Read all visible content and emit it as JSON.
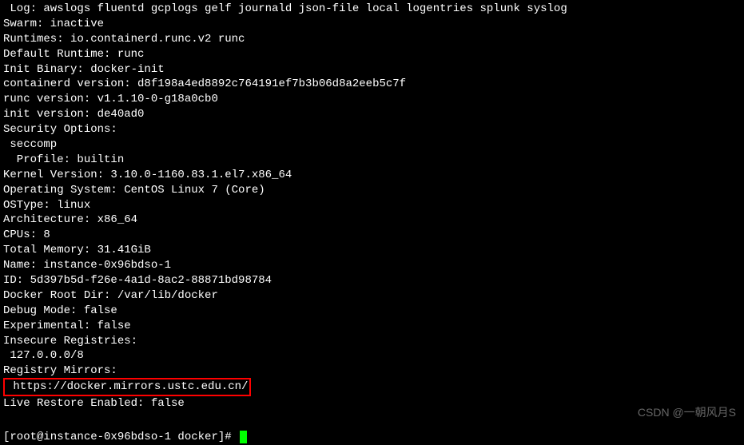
{
  "lines": {
    "log": " Log: awslogs fluentd gcplogs gelf journald json-file local logentries splunk syslog",
    "swarm": "Swarm: inactive",
    "runtimes": "Runtimes: io.containerd.runc.v2 runc",
    "default_runtime": "Default Runtime: runc",
    "init_binary": "Init Binary: docker-init",
    "containerd_version": "containerd version: d8f198a4ed8892c764191ef7b3b06d8a2eeb5c7f",
    "runc_version": "runc version: v1.1.10-0-g18a0cb0",
    "init_version": "init version: de40ad0",
    "security_options": "Security Options:",
    "seccomp": " seccomp",
    "profile": "  Profile: builtin",
    "kernel_version": "Kernel Version: 3.10.0-1160.83.1.el7.x86_64",
    "operating_system": "Operating System: CentOS Linux 7 (Core)",
    "ostype": "OSType: linux",
    "architecture": "Architecture: x86_64",
    "cpus": "CPUs: 8",
    "total_memory": "Total Memory: 31.41GiB",
    "name": "Name: instance-0x96bdso-1",
    "id": "ID: 5d397b5d-f26e-4a1d-8ac2-88871bd98784",
    "docker_root_dir": "Docker Root Dir: /var/lib/docker",
    "debug_mode": "Debug Mode: false",
    "experimental": "Experimental: false",
    "insecure_registries": "Insecure Registries:",
    "insecure_entry": " 127.0.0.0/8",
    "registry_mirrors": "Registry Mirrors:",
    "mirror_url": " https://docker.mirrors.ustc.edu.cn/",
    "live_restore": "Live Restore Enabled: false"
  },
  "prompt": "[root@instance-0x96bdso-1 docker]# ",
  "watermark": "CSDN @一朝风月S"
}
